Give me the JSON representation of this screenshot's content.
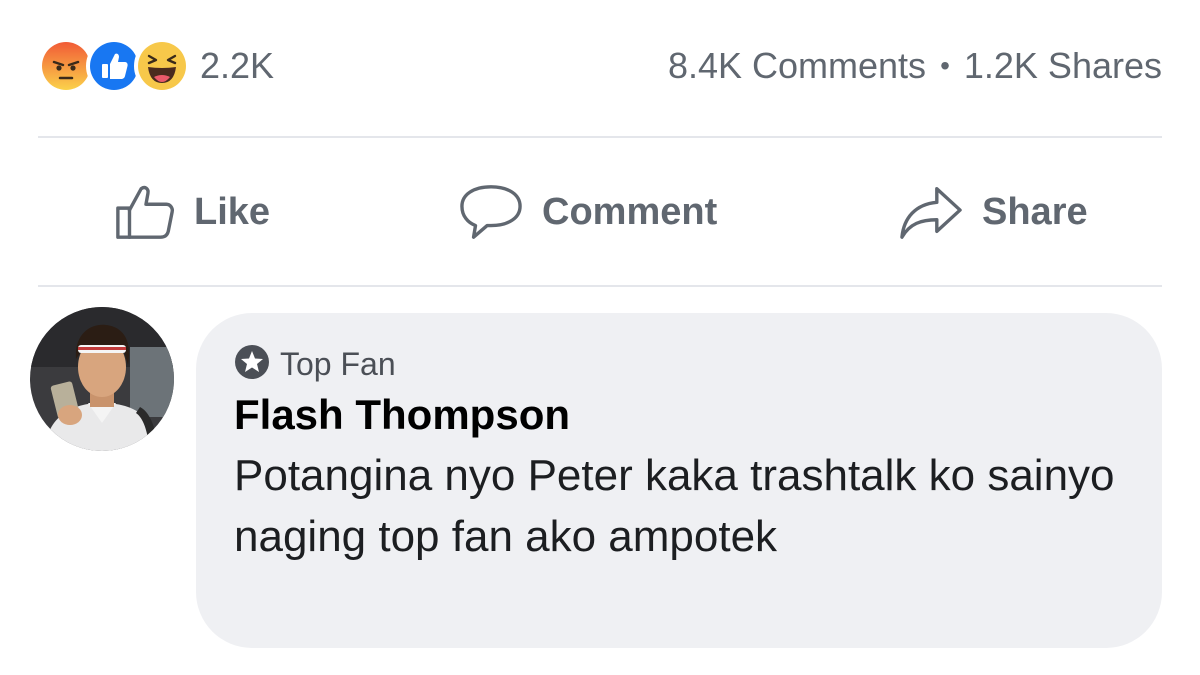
{
  "post_stats": {
    "reactions": [
      {
        "name": "angry",
        "icon": "angry-reaction-icon",
        "color": "#f7714c"
      },
      {
        "name": "like",
        "icon": "like-reaction-icon",
        "color": "#1877f2"
      },
      {
        "name": "haha",
        "icon": "haha-reaction-icon",
        "color": "#f7c84a"
      }
    ],
    "reaction_count": "2.2K",
    "comments": "8.4K Comments",
    "separator": "•",
    "shares": "1.2K Shares"
  },
  "actions": {
    "like_label": "Like",
    "comment_label": "Comment",
    "share_label": "Share"
  },
  "comment": {
    "badge_label": "Top Fan",
    "author": "Flash Thompson",
    "text": "Potangina nyo Peter kaka trashtalk ko sainyo naging top fan ako ampotek"
  },
  "colors": {
    "muted_text": "#606770",
    "bubble_bg": "#eff0f3",
    "divider": "#e4e6eb"
  }
}
